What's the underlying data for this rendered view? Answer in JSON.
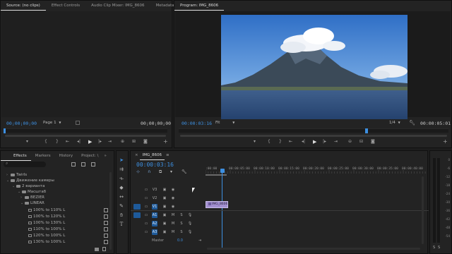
{
  "source": {
    "tabs": [
      "Source: (no clips)",
      "Effect Controls",
      "Audio Clip Mixer: IMG_8606",
      "Metadata"
    ],
    "timecode_left": "00;00;00;00",
    "page_label": "Page 1",
    "timecode_right": "00;00;00;00"
  },
  "program": {
    "title": "Program: IMG_8606",
    "timecode_left": "00:00:03:16",
    "fit_label": "Fit",
    "fraction": "1/4",
    "timecode_right": "00:00:05:01"
  },
  "effects": {
    "tabs": [
      "Effects",
      "Markers",
      "History",
      "Project: \\"
    ],
    "tree": [
      {
        "label": "Twirls",
        "level": 0,
        "type": "folder"
      },
      {
        "label": "Движение камеры",
        "level": 0,
        "type": "folder",
        "open": true
      },
      {
        "label": "2 варианта",
        "level": 1,
        "type": "folder",
        "open": true
      },
      {
        "label": "Масштаб",
        "level": 2,
        "type": "folder",
        "open": true
      },
      {
        "label": "BEZIER",
        "level": 3,
        "type": "folder"
      },
      {
        "label": "LINEAR",
        "level": 3,
        "type": "folder",
        "open": true
      },
      {
        "label": "100% to 110% L",
        "level": 4,
        "type": "preset"
      },
      {
        "label": "100% to 120% L",
        "level": 4,
        "type": "preset"
      },
      {
        "label": "100% to 130% L",
        "level": 4,
        "type": "preset"
      },
      {
        "label": "110% to 100% L",
        "level": 4,
        "type": "preset"
      },
      {
        "label": "120% to 100% L",
        "level": 4,
        "type": "preset"
      },
      {
        "label": "130% to 100% L",
        "level": 4,
        "type": "preset"
      }
    ]
  },
  "timeline": {
    "tab": "IMG_8606",
    "timecode": "00:00:03:16",
    "ruler_labels": [
      ":00:00",
      "00:00:05:00",
      "00:00:10:00",
      "00:00:15:00",
      "00:00:20:00",
      "00:00:25:00",
      "00:00:30:00",
      "00:00:35:00",
      "00:00:40:00",
      "00:0"
    ],
    "video_tracks": [
      "V3",
      "V2",
      "V1"
    ],
    "audio_tracks": [
      "A1",
      "A2",
      "A3"
    ],
    "master_label": "Master",
    "master_value": "0.0",
    "clip_label": "IMG_8606",
    "playhead_seconds": 3.53
  },
  "tools": [
    "selection-tool",
    "track-select-tool",
    "ripple-edit-tool",
    "razor-tool",
    "slip-tool",
    "pen-tool",
    "hand-tool",
    "type-tool"
  ],
  "audio_meter": {
    "ticks": [
      "0",
      "-6",
      "-12",
      "-18",
      "-24",
      "-30",
      "-36",
      "-42",
      "-48",
      "-54"
    ],
    "bottom_labels": [
      "S",
      "S"
    ]
  },
  "colors": {
    "accent_blue": "#3d8fe0",
    "track_blue": "#1e5a9a",
    "clip_purple": "#a28fcf"
  }
}
